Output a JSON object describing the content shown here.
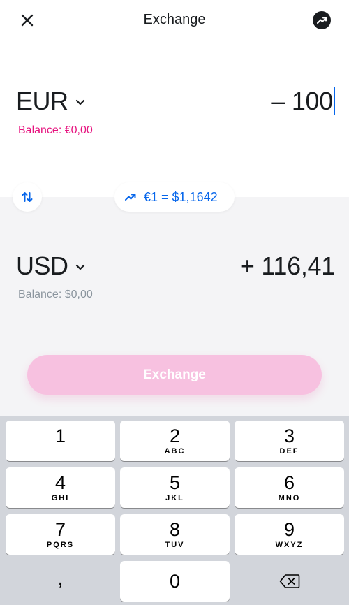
{
  "header": {
    "title": "Exchange",
    "close_icon": "close-icon",
    "chart_icon": "trending-up-icon"
  },
  "from": {
    "currency": "EUR",
    "amount": "– 100",
    "balance": "Balance: €0,00",
    "balance_color": "#e6127e"
  },
  "to": {
    "currency": "USD",
    "amount": "+ 116,41",
    "balance": "Balance: $0,00"
  },
  "rate": {
    "text": "€1 = $1,1642",
    "icon": "trending-up-icon",
    "color": "#0666eb"
  },
  "swap_icon": "swap-vertical-icon",
  "exchange_button": {
    "label": "Exchange",
    "color": "#f7c1e0"
  },
  "keyboard": {
    "keys": [
      {
        "num": "1",
        "letters": ""
      },
      {
        "num": "2",
        "letters": "ABC"
      },
      {
        "num": "3",
        "letters": "DEF"
      },
      {
        "num": "4",
        "letters": "GHI"
      },
      {
        "num": "5",
        "letters": "JKL"
      },
      {
        "num": "6",
        "letters": "MNO"
      },
      {
        "num": "7",
        "letters": "PQRS"
      },
      {
        "num": "8",
        "letters": "TUV"
      },
      {
        "num": "9",
        "letters": "WXYZ"
      },
      {
        "num": "0",
        "letters": ""
      }
    ],
    "comma": ",",
    "delete_icon": "backspace-icon"
  }
}
